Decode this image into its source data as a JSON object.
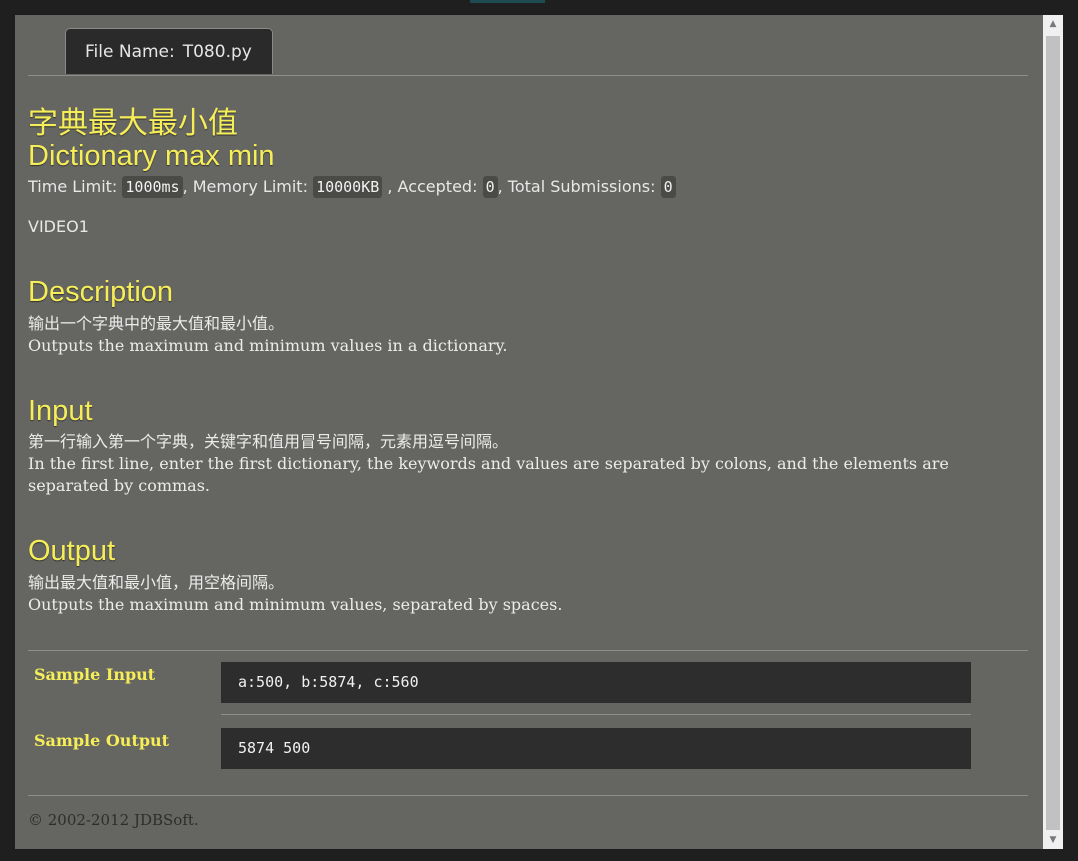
{
  "tab": {
    "label": "File Name:",
    "filename": "T080.py"
  },
  "problem": {
    "title_zh": "字典最大最小值",
    "title_en": "Dictionary max min",
    "meta": {
      "time_label": "Time Limit:",
      "time_value": "1000ms",
      "memory_label": ", Memory Limit:",
      "memory_value": "10000KB",
      "accepted_label": ", Accepted:",
      "accepted_value": "0",
      "submissions_label": ", Total Submissions:",
      "submissions_value": "0"
    },
    "video": "VIDEO1"
  },
  "description": {
    "heading": "Description",
    "zh": "输出一个字典中的最大值和最小值。",
    "en": "Outputs the maximum and minimum values in a dictionary."
  },
  "input": {
    "heading": "Input",
    "zh": "第一行输入第一个字典，关键字和值用冒号间隔，元素用逗号间隔。",
    "en": "In the first line, enter the first dictionary, the keywords and values are separated by colons, and the elements are separated by commas."
  },
  "output": {
    "heading": "Output",
    "zh": "输出最大值和最小值，用空格间隔。",
    "en": "Outputs the maximum and minimum values, separated by spaces."
  },
  "samples": {
    "input_label": "Sample Input",
    "input_value": "a:500, b:5874, c:560",
    "output_label": "Sample Output",
    "output_value": "5874 500"
  },
  "footer": {
    "copyright": "© 2002-2012  JDBSoft."
  },
  "scrollbar": {
    "up_glyph": "▲",
    "down_glyph": "▼"
  },
  "colors": {
    "heading": "#f6ee58",
    "background": "#656561",
    "code_box": "#2d2d2d"
  }
}
